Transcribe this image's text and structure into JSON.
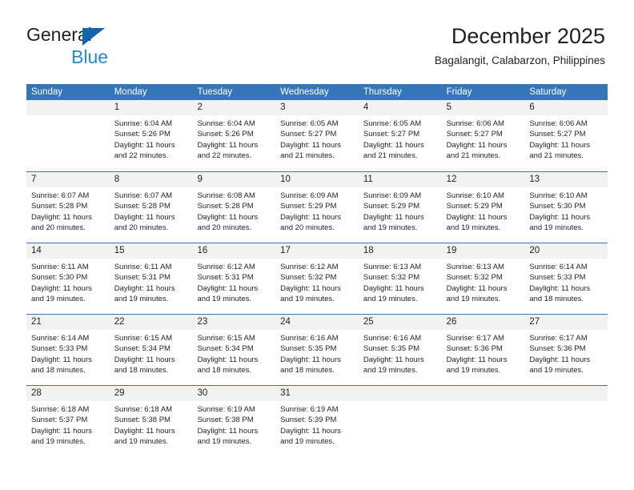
{
  "brand": {
    "name_part1": "General",
    "name_part2": "Blue",
    "triangle_color": "#1263b0",
    "blue_text_color": "#2389d4"
  },
  "header": {
    "title": "December 2025",
    "subtitle": "Bagalangit, Calabarzon, Philippines"
  },
  "colors": {
    "header_blue": "#3576b8",
    "day_band_gray": "#f2f2f2",
    "text": "#231f20"
  },
  "weekdays": [
    "Sunday",
    "Monday",
    "Tuesday",
    "Wednesday",
    "Thursday",
    "Friday",
    "Saturday"
  ],
  "weeks": [
    [
      {
        "day": "",
        "sunrise": "",
        "sunset": "",
        "daylight1": "",
        "daylight2": ""
      },
      {
        "day": "1",
        "sunrise": "Sunrise: 6:04 AM",
        "sunset": "Sunset: 5:26 PM",
        "daylight1": "Daylight: 11 hours",
        "daylight2": "and 22 minutes."
      },
      {
        "day": "2",
        "sunrise": "Sunrise: 6:04 AM",
        "sunset": "Sunset: 5:26 PM",
        "daylight1": "Daylight: 11 hours",
        "daylight2": "and 22 minutes."
      },
      {
        "day": "3",
        "sunrise": "Sunrise: 6:05 AM",
        "sunset": "Sunset: 5:27 PM",
        "daylight1": "Daylight: 11 hours",
        "daylight2": "and 21 minutes."
      },
      {
        "day": "4",
        "sunrise": "Sunrise: 6:05 AM",
        "sunset": "Sunset: 5:27 PM",
        "daylight1": "Daylight: 11 hours",
        "daylight2": "and 21 minutes."
      },
      {
        "day": "5",
        "sunrise": "Sunrise: 6:06 AM",
        "sunset": "Sunset: 5:27 PM",
        "daylight1": "Daylight: 11 hours",
        "daylight2": "and 21 minutes."
      },
      {
        "day": "6",
        "sunrise": "Sunrise: 6:06 AM",
        "sunset": "Sunset: 5:27 PM",
        "daylight1": "Daylight: 11 hours",
        "daylight2": "and 21 minutes."
      }
    ],
    [
      {
        "day": "7",
        "sunrise": "Sunrise: 6:07 AM",
        "sunset": "Sunset: 5:28 PM",
        "daylight1": "Daylight: 11 hours",
        "daylight2": "and 20 minutes."
      },
      {
        "day": "8",
        "sunrise": "Sunrise: 6:07 AM",
        "sunset": "Sunset: 5:28 PM",
        "daylight1": "Daylight: 11 hours",
        "daylight2": "and 20 minutes."
      },
      {
        "day": "9",
        "sunrise": "Sunrise: 6:08 AM",
        "sunset": "Sunset: 5:28 PM",
        "daylight1": "Daylight: 11 hours",
        "daylight2": "and 20 minutes."
      },
      {
        "day": "10",
        "sunrise": "Sunrise: 6:09 AM",
        "sunset": "Sunset: 5:29 PM",
        "daylight1": "Daylight: 11 hours",
        "daylight2": "and 20 minutes."
      },
      {
        "day": "11",
        "sunrise": "Sunrise: 6:09 AM",
        "sunset": "Sunset: 5:29 PM",
        "daylight1": "Daylight: 11 hours",
        "daylight2": "and 19 minutes."
      },
      {
        "day": "12",
        "sunrise": "Sunrise: 6:10 AM",
        "sunset": "Sunset: 5:29 PM",
        "daylight1": "Daylight: 11 hours",
        "daylight2": "and 19 minutes."
      },
      {
        "day": "13",
        "sunrise": "Sunrise: 6:10 AM",
        "sunset": "Sunset: 5:30 PM",
        "daylight1": "Daylight: 11 hours",
        "daylight2": "and 19 minutes."
      }
    ],
    [
      {
        "day": "14",
        "sunrise": "Sunrise: 6:11 AM",
        "sunset": "Sunset: 5:30 PM",
        "daylight1": "Daylight: 11 hours",
        "daylight2": "and 19 minutes."
      },
      {
        "day": "15",
        "sunrise": "Sunrise: 6:11 AM",
        "sunset": "Sunset: 5:31 PM",
        "daylight1": "Daylight: 11 hours",
        "daylight2": "and 19 minutes."
      },
      {
        "day": "16",
        "sunrise": "Sunrise: 6:12 AM",
        "sunset": "Sunset: 5:31 PM",
        "daylight1": "Daylight: 11 hours",
        "daylight2": "and 19 minutes."
      },
      {
        "day": "17",
        "sunrise": "Sunrise: 6:12 AM",
        "sunset": "Sunset: 5:32 PM",
        "daylight1": "Daylight: 11 hours",
        "daylight2": "and 19 minutes."
      },
      {
        "day": "18",
        "sunrise": "Sunrise: 6:13 AM",
        "sunset": "Sunset: 5:32 PM",
        "daylight1": "Daylight: 11 hours",
        "daylight2": "and 19 minutes."
      },
      {
        "day": "19",
        "sunrise": "Sunrise: 6:13 AM",
        "sunset": "Sunset: 5:32 PM",
        "daylight1": "Daylight: 11 hours",
        "daylight2": "and 19 minutes."
      },
      {
        "day": "20",
        "sunrise": "Sunrise: 6:14 AM",
        "sunset": "Sunset: 5:33 PM",
        "daylight1": "Daylight: 11 hours",
        "daylight2": "and 18 minutes."
      }
    ],
    [
      {
        "day": "21",
        "sunrise": "Sunrise: 6:14 AM",
        "sunset": "Sunset: 5:33 PM",
        "daylight1": "Daylight: 11 hours",
        "daylight2": "and 18 minutes."
      },
      {
        "day": "22",
        "sunrise": "Sunrise: 6:15 AM",
        "sunset": "Sunset: 5:34 PM",
        "daylight1": "Daylight: 11 hours",
        "daylight2": "and 18 minutes."
      },
      {
        "day": "23",
        "sunrise": "Sunrise: 6:15 AM",
        "sunset": "Sunset: 5:34 PM",
        "daylight1": "Daylight: 11 hours",
        "daylight2": "and 18 minutes."
      },
      {
        "day": "24",
        "sunrise": "Sunrise: 6:16 AM",
        "sunset": "Sunset: 5:35 PM",
        "daylight1": "Daylight: 11 hours",
        "daylight2": "and 18 minutes."
      },
      {
        "day": "25",
        "sunrise": "Sunrise: 6:16 AM",
        "sunset": "Sunset: 5:35 PM",
        "daylight1": "Daylight: 11 hours",
        "daylight2": "and 19 minutes."
      },
      {
        "day": "26",
        "sunrise": "Sunrise: 6:17 AM",
        "sunset": "Sunset: 5:36 PM",
        "daylight1": "Daylight: 11 hours",
        "daylight2": "and 19 minutes."
      },
      {
        "day": "27",
        "sunrise": "Sunrise: 6:17 AM",
        "sunset": "Sunset: 5:36 PM",
        "daylight1": "Daylight: 11 hours",
        "daylight2": "and 19 minutes."
      }
    ],
    [
      {
        "day": "28",
        "sunrise": "Sunrise: 6:18 AM",
        "sunset": "Sunset: 5:37 PM",
        "daylight1": "Daylight: 11 hours",
        "daylight2": "and 19 minutes."
      },
      {
        "day": "29",
        "sunrise": "Sunrise: 6:18 AM",
        "sunset": "Sunset: 5:38 PM",
        "daylight1": "Daylight: 11 hours",
        "daylight2": "and 19 minutes."
      },
      {
        "day": "30",
        "sunrise": "Sunrise: 6:19 AM",
        "sunset": "Sunset: 5:38 PM",
        "daylight1": "Daylight: 11 hours",
        "daylight2": "and 19 minutes."
      },
      {
        "day": "31",
        "sunrise": "Sunrise: 6:19 AM",
        "sunset": "Sunset: 5:39 PM",
        "daylight1": "Daylight: 11 hours",
        "daylight2": "and 19 minutes."
      },
      {
        "day": "",
        "sunrise": "",
        "sunset": "",
        "daylight1": "",
        "daylight2": ""
      },
      {
        "day": "",
        "sunrise": "",
        "sunset": "",
        "daylight1": "",
        "daylight2": ""
      },
      {
        "day": "",
        "sunrise": "",
        "sunset": "",
        "daylight1": "",
        "daylight2": ""
      }
    ]
  ]
}
